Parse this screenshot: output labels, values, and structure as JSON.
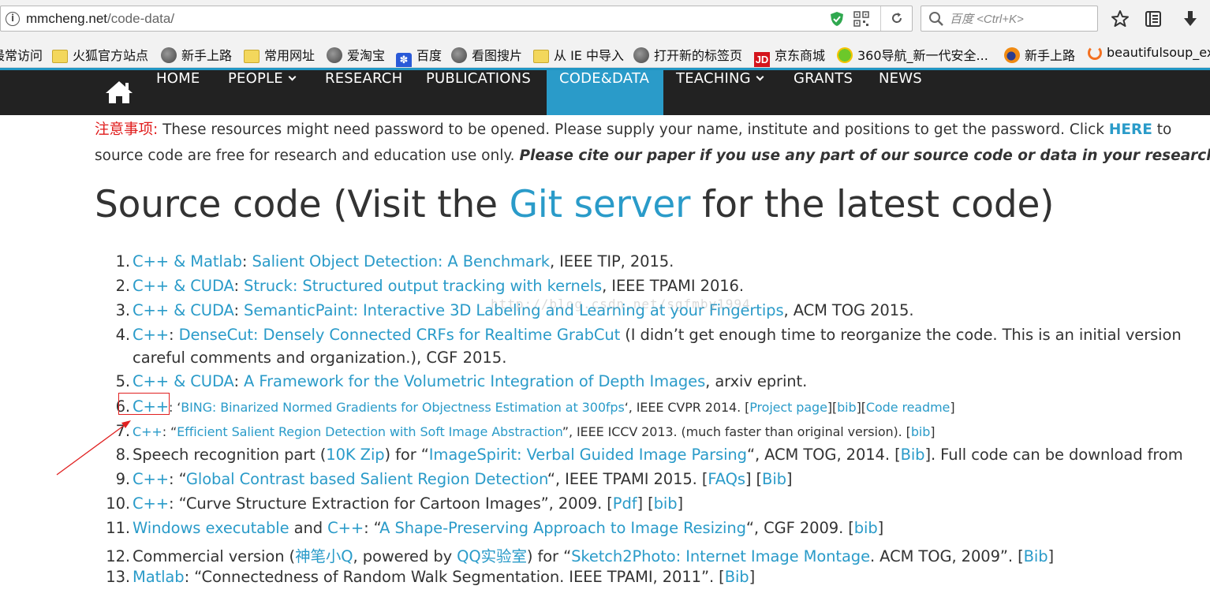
{
  "browser": {
    "url_host": "mmcheng.net",
    "url_path": "/code-data/",
    "search_placeholder": "百度 <Ctrl+K>",
    "bookmarks": [
      {
        "label": "最常访问",
        "icon": "none"
      },
      {
        "label": "火狐官方站点",
        "icon": "folder-icon"
      },
      {
        "label": "新手上路",
        "icon": "globe-icon"
      },
      {
        "label": "常用网址",
        "icon": "folder-icon"
      },
      {
        "label": "爱淘宝",
        "icon": "globe-icon"
      },
      {
        "label": "百度",
        "icon": "baidu-paw-icon"
      },
      {
        "label": "看图搜片",
        "icon": "globe-icon"
      },
      {
        "label": "从 IE 中导入",
        "icon": "folder-icon"
      },
      {
        "label": "打开新的标签页",
        "icon": "globe-icon"
      },
      {
        "label": "京东商城",
        "icon": "jd-icon"
      },
      {
        "label": "360导航_新一代安全...",
        "icon": "360-icon"
      },
      {
        "label": "新手上路",
        "icon": "firefox-icon"
      },
      {
        "label": "beautifulsoup_ex",
        "icon": "beautifulsoup-icon"
      }
    ]
  },
  "nav": {
    "items": [
      {
        "label": "HOME"
      },
      {
        "label": "PEOPLE"
      },
      {
        "label": "RESEARCH"
      },
      {
        "label": "PUBLICATIONS"
      },
      {
        "label": "CODE&DATA"
      },
      {
        "label": "TEACHING"
      },
      {
        "label": "GRANTS"
      },
      {
        "label": "NEWS"
      }
    ],
    "active_color": "#2a9bc9"
  },
  "notice": {
    "label": "注意事项:",
    "text1": " These resources might need password to be opened. Please supply your name, institute and positions to get the password. Click ",
    "here": "HERE",
    "text2": " to",
    "line2": "source code are free for research and education use only. ",
    "cite": "Please cite our paper if you use any part of our source code or data in your research",
    "period": "."
  },
  "heading": {
    "pre": "Source code (Visit the ",
    "link": "Git server",
    "post": " for the latest code)"
  },
  "items": {
    "i1": {
      "num": "1.",
      "a": "C++ & Matlab",
      "b": ": ",
      "c": "Salient Object Detection: A Benchmark",
      "d": ", IEEE TIP, 2015."
    },
    "i2": {
      "num": "2.",
      "a": "C++ & CUDA",
      "b": ": ",
      "c": "Struck: Structured output tracking with kernels",
      "d": ", IEEE TPAMI 2016."
    },
    "i3": {
      "num": "3.",
      "a": "C++ & CUDA",
      "b": ": ",
      "c": "SemanticPaint: Interactive 3D Labeling and Learning at your Fingertips",
      "d": ", ACM TOG 2015."
    },
    "i4": {
      "num": "4.",
      "a": "C++",
      "b": ": ",
      "c": "DenseCut: Densely Connected CRFs for Realtime GrabCut",
      "d": " (I didn’t get enough time to reorganize the code. This is an initial version",
      "e": "careful comments and organization.), CGF 2015."
    },
    "i5": {
      "num": "5.",
      "a": "C++ & CUDA",
      "b": ": ",
      "c": "A Framework for the Volumetric Integration of Depth Images",
      "d": ", arxiv eprint."
    },
    "i6": {
      "num": "6.",
      "a": "C++",
      "b": ": ‘",
      "c": "BING: Binarized Normed Gradients for Objectness Estimation at 300fps",
      "d": "‘, IEEE CVPR 2014. [",
      "e": "Project page",
      "f": "][",
      "g": "bib",
      "h": "][",
      "i": "Code readme",
      "j": "]"
    },
    "i7": {
      "num": "7.",
      "a": "C++",
      "b": ": “",
      "c": "Efficient Salient Region Detection with Soft Image Abstraction",
      "d": "”, IEEE ICCV 2013. (much faster than original version). [",
      "e": "bib",
      "f": "]"
    },
    "i8": {
      "num": "8.",
      "a": "Speech recognition part (",
      "b": "10K Zip",
      "c": ") for “",
      "d": "ImageSpirit: Verbal Guided Image Parsing",
      "e": "“, ACM TOG, 2014. [",
      "f": "Bib",
      "g": "]. Full code can be download from"
    },
    "i9": {
      "num": "9.",
      "a": "C++",
      "b": ": “",
      "c": "Global Contrast based Salient Region Detection",
      "d": "“, IEEE TPAMI 2015. [",
      "e": "FAQs",
      "f": "] [",
      "g": "Bib",
      "h": "]"
    },
    "i10": {
      "num": "10.",
      "a": "C++",
      "b": ": “Curve Structure Extraction for Cartoon Images”, 2009. [",
      "c": "Pdf",
      "d": "] [",
      "e": "bib",
      "f": "]"
    },
    "i11": {
      "num": "11.",
      "a": "Windows executable",
      "b": " and ",
      "c": "C++",
      "d": ": “",
      "e": "A Shape-Preserving Approach to Image Resizing",
      "f": "“, CGF 2009. [",
      "g": "bib",
      "h": "]"
    },
    "i12": {
      "num": "12.",
      "a": "Commercial version (",
      "b": "神笔小Q",
      "c": ", powered by ",
      "d": "QQ实验室",
      "e": ") for “",
      "f": "Sketch2Photo: Internet Image Montage",
      "g": ". ACM TOG, 2009”. [",
      "h": "Bib",
      "i": "]"
    },
    "i13": {
      "num": "13.",
      "a": "Matlab",
      "b": ": “Connectedness of Random Walk Segmentation. IEEE TPAMI, 2011”. [",
      "c": "Bib",
      "d": "]"
    }
  },
  "watermark": "http://blog.csdn.net/sgfmby1994",
  "colors": {
    "link": "#2a9bc9",
    "nav_bg": "#222222",
    "notice_red": "#e01b1b",
    "annotation_red": "#e02020"
  }
}
